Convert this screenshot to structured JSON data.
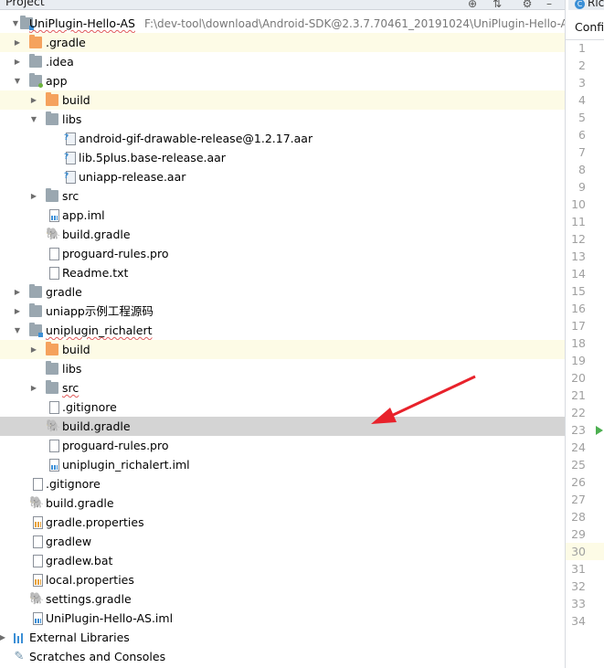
{
  "panel": {
    "title": "Project",
    "icons": [
      "globe-icon",
      "collapse-all-icon",
      "gear-icon",
      "minimize-icon"
    ]
  },
  "tree": [
    {
      "label": "UniPlugin-Hello-AS",
      "path": "F:\\dev-tool\\download\\Android-SDK@2.3.7.70461_20191024\\UniPlugin-Hello-AS",
      "icon": "module-folder-icon",
      "expanded": true
    },
    {
      "label": ".gradle",
      "icon": "folder-icon",
      "expanded": false
    },
    {
      "label": ".idea",
      "icon": "folder-icon",
      "expanded": false
    },
    {
      "label": "app",
      "icon": "module-folder-icon",
      "expanded": true
    },
    {
      "label": "build",
      "icon": "folder-icon",
      "expanded": false
    },
    {
      "label": "libs",
      "icon": "folder-icon",
      "expanded": true
    },
    {
      "label": "android-gif-drawable-release@1.2.17.aar",
      "icon": "aar-file-icon"
    },
    {
      "label": "lib.5plus.base-release.aar",
      "icon": "aar-file-icon"
    },
    {
      "label": "uniapp-release.aar",
      "icon": "aar-file-icon"
    },
    {
      "label": "src",
      "icon": "folder-icon",
      "expanded": false
    },
    {
      "label": "app.iml",
      "icon": "iml-file-icon"
    },
    {
      "label": "build.gradle",
      "icon": "gradle-icon"
    },
    {
      "label": "proguard-rules.pro",
      "icon": "text-file-icon"
    },
    {
      "label": "Readme.txt",
      "icon": "text-file-icon"
    },
    {
      "label": "gradle",
      "icon": "folder-icon",
      "expanded": false
    },
    {
      "label": "uniapp示例工程源码",
      "icon": "folder-icon",
      "expanded": false
    },
    {
      "label": "uniplugin_richalert",
      "icon": "module-folder-icon",
      "expanded": true
    },
    {
      "label": "build",
      "icon": "folder-icon",
      "expanded": false
    },
    {
      "label": "libs",
      "icon": "folder-icon"
    },
    {
      "label": "src",
      "icon": "folder-icon",
      "expanded": false
    },
    {
      "label": ".gitignore",
      "icon": "text-file-icon"
    },
    {
      "label": "build.gradle",
      "icon": "gradle-icon",
      "selected": true
    },
    {
      "label": "proguard-rules.pro",
      "icon": "text-file-icon"
    },
    {
      "label": "uniplugin_richalert.iml",
      "icon": "iml-file-icon"
    },
    {
      "label": ".gitignore",
      "icon": "text-file-icon"
    },
    {
      "label": "build.gradle",
      "icon": "gradle-icon"
    },
    {
      "label": "gradle.properties",
      "icon": "properties-file-icon"
    },
    {
      "label": "gradlew",
      "icon": "text-file-icon"
    },
    {
      "label": "gradlew.bat",
      "icon": "text-file-icon"
    },
    {
      "label": "local.properties",
      "icon": "properties-file-icon"
    },
    {
      "label": "settings.gradle",
      "icon": "gradle-icon"
    },
    {
      "label": "UniPlugin-Hello-AS.iml",
      "icon": "iml-file-icon"
    },
    {
      "label": "External Libraries",
      "icon": "external-libraries-icon",
      "expanded": false
    },
    {
      "label": "Scratches and Consoles",
      "icon": "scratches-icon"
    }
  ],
  "editor": {
    "tab_label": "Ric",
    "breadcrumb": "Config",
    "line_numbers": [
      "1",
      "2",
      "3",
      "4",
      "5",
      "6",
      "7",
      "8",
      "9",
      "10",
      "11",
      "12",
      "13",
      "14",
      "15",
      "16",
      "17",
      "18",
      "19",
      "20",
      "21",
      "22",
      "23",
      "24",
      "25",
      "26",
      "27",
      "28",
      "29",
      "30",
      "31",
      "32",
      "33",
      "34"
    ],
    "current_line": "30",
    "run_marker_line": "23"
  },
  "colors": {
    "selection": "#d4d4d4",
    "excluded_highlight": "#fdfbe6",
    "annotation_arrow": "#e8222b",
    "accent": "#3b8fd6"
  }
}
